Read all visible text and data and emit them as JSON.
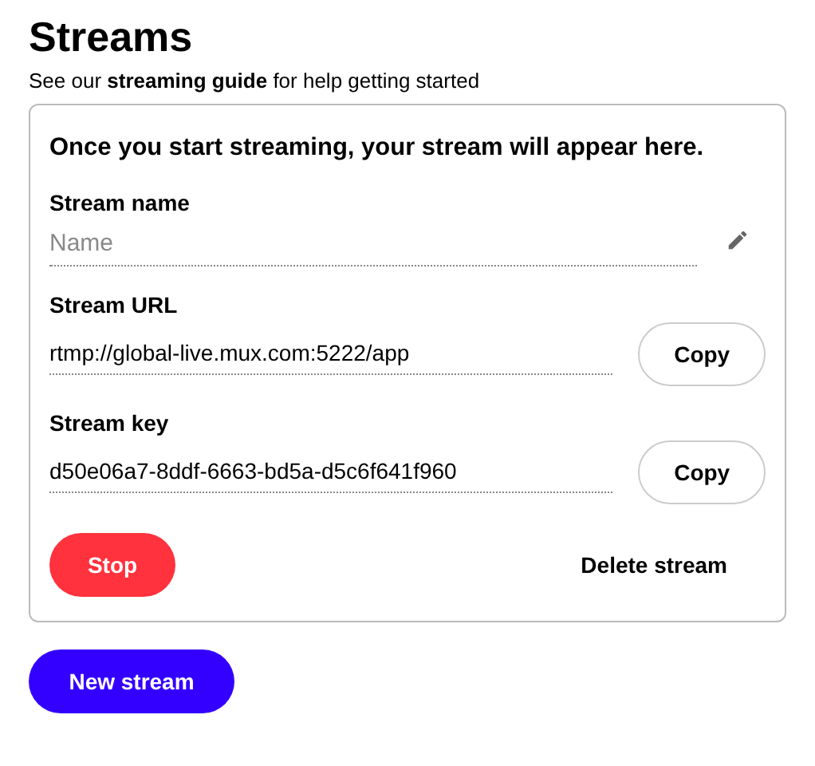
{
  "title": "Streams",
  "subtitle": "See our **streaming guide** for help getting started",
  "card": {
    "heading": "Once you start streaming, your stream will appear here.",
    "fields": [
      {
        "kind": "editable",
        "label": "Stream name",
        "placeholder": "Name"
      },
      {
        "kind": "copyable",
        "label": "Stream URL",
        "value": "rtmp://global-live.mux.com:5222/app",
        "button": "Copy"
      },
      {
        "kind": "copyable",
        "label": "Stream key",
        "value": "d50e06a7-8ddf-6663-bd5a-d5c6f641f960",
        "button": "Copy"
      }
    ],
    "stop_button": "Stop",
    "delete_button": "Delete stream"
  },
  "new_button": "New stream"
}
